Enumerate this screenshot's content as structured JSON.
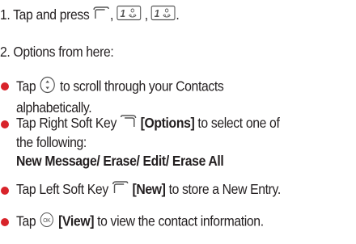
{
  "step1": {
    "prefix": "1. Tap and press",
    "key_label_1": "1",
    "key_label_2": "1",
    "sep": ",",
    "end": "."
  },
  "step2": {
    "text": "2. Options from here:"
  },
  "bullets": [
    {
      "line1_prefix": "Tap",
      "line1_suffix": "to scroll through your Contacts",
      "line2": "alphabetically."
    },
    {
      "line1_prefix": "Tap Right Soft Key",
      "line1_bold": "[Options]",
      "line1_suffix": "to select one of",
      "line2": "the following:",
      "line3_bold": "New Message/ Erase/ Edit/ Erase All"
    },
    {
      "line1_prefix": "Tap Left Soft Key",
      "line1_bold": "[New]",
      "line1_suffix": "to store a New Entry."
    },
    {
      "line1_prefix": "Tap",
      "ok_label": "OK",
      "line1_bold": "[View]",
      "line1_suffix": "to view the contact information."
    }
  ],
  "colors": {
    "bullet": "#d8232a",
    "text": "#231f20",
    "icon_stroke": "#555555"
  },
  "icons": [
    "left-soft-key-icon",
    "number-one-key-icon",
    "navigation-key-icon",
    "right-soft-key-icon",
    "ok-key-icon"
  ]
}
